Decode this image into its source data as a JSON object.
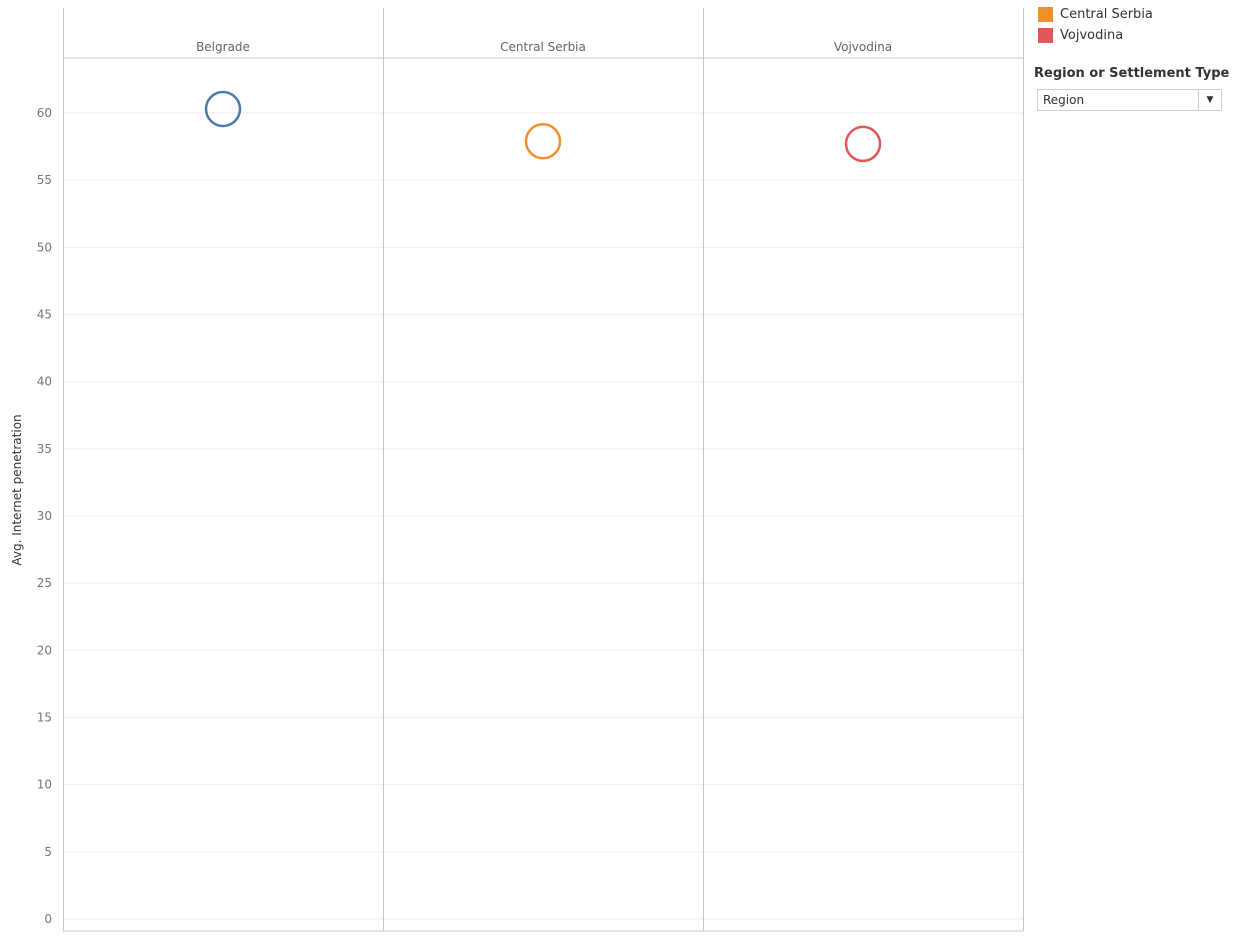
{
  "chart_data": {
    "type": "scatter",
    "ylabel": "Avg. Internet penetration",
    "categories": [
      "Belgrade",
      "Central Serbia",
      "Vojvodina"
    ],
    "values": [
      60.3,
      57.9,
      57.7
    ],
    "colors": [
      "#4e79a7",
      "#f28e2b",
      "#e15759"
    ],
    "ylim": [
      0,
      65
    ],
    "yticks": [
      0,
      5,
      10,
      15,
      20,
      25,
      30,
      35,
      40,
      45,
      50,
      55,
      60
    ],
    "marker": "open-circle",
    "grid": true
  },
  "legend": {
    "items": [
      {
        "label": "Central Serbia",
        "color": "#f28e2b"
      },
      {
        "label": "Vojvodina",
        "color": "#e15759"
      }
    ]
  },
  "filter": {
    "title": "Region or Settlement Type",
    "value": "Region"
  }
}
